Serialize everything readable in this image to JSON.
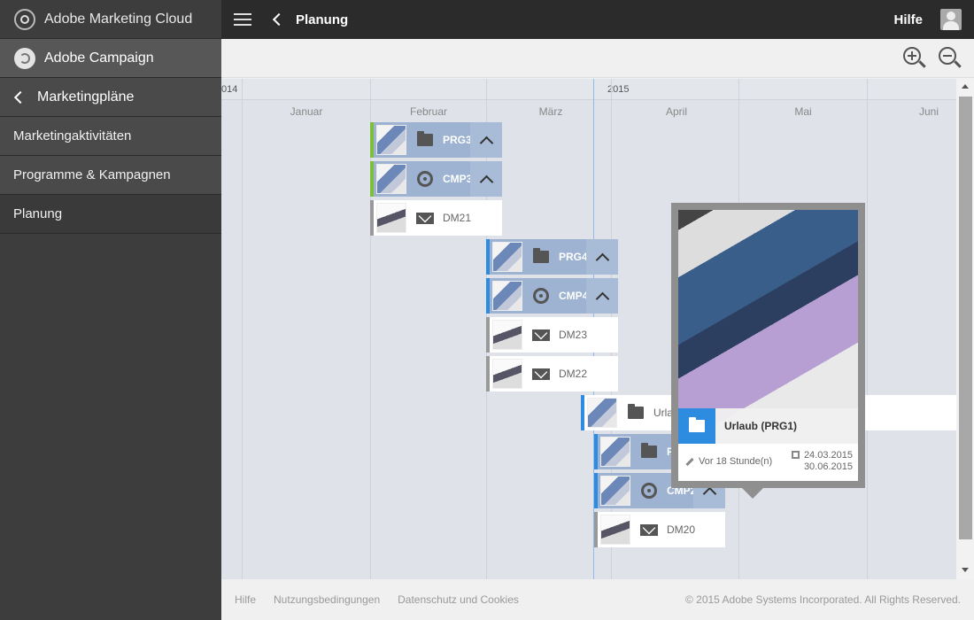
{
  "sidebar": {
    "marketing_cloud": "Adobe Marketing Cloud",
    "campaign": "Adobe Campaign",
    "back_label": "Marketingpläne",
    "items": [
      {
        "label": "Marketingaktivitäten"
      },
      {
        "label": "Programme & Kampagnen"
      },
      {
        "label": "Planung"
      }
    ]
  },
  "topbar": {
    "title": "Planung",
    "help": "Hilfe"
  },
  "timeline": {
    "years": [
      "014",
      "2015"
    ],
    "months": [
      "Januar",
      "Februar",
      "März",
      "April",
      "Mai",
      "Juni"
    ],
    "bars": [
      {
        "label": "PRG3"
      },
      {
        "label": "CMP3"
      },
      {
        "label": "DM21"
      },
      {
        "label": "PRG4"
      },
      {
        "label": "CMP4"
      },
      {
        "label": "DM23"
      },
      {
        "label": "DM22"
      },
      {
        "label": "Urlau"
      },
      {
        "label": "PR"
      },
      {
        "label": "CMP2"
      },
      {
        "label": "DM20"
      }
    ]
  },
  "tooltip": {
    "title": "Urlaub (PRG1)",
    "modified": "Vor 18 Stunde(n)",
    "start": "24.03.2015",
    "end": "30.06.2015"
  },
  "footer": {
    "links": [
      "Hilfe",
      "Nutzungsbedingungen",
      "Datenschutz und Cookies"
    ],
    "copyright": "© 2015 Adobe Systems Incorporated. All Rights Reserved."
  },
  "colors": {
    "accent": "#2d8ce0",
    "bar_blue": "#9db3d1",
    "edge_green": "#7bbf3a"
  }
}
